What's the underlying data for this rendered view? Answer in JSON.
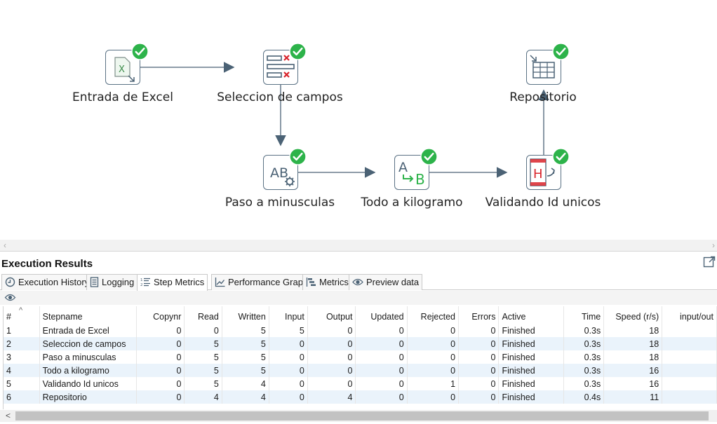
{
  "steps": [
    {
      "id": "excel",
      "label": "Entrada de Excel"
    },
    {
      "id": "select",
      "label": "Seleccion de campos"
    },
    {
      "id": "lower",
      "label": "Paso a minusculas"
    },
    {
      "id": "kilo",
      "label": "Todo a kilogramo"
    },
    {
      "id": "unique",
      "label": "Validando Id unicos"
    },
    {
      "id": "repo",
      "label": "Repositorio"
    }
  ],
  "colors": {
    "hop": "#4b6275",
    "check": "#2db34a",
    "accent_red": "#d9242c"
  },
  "scroll_top": {
    "left": "‹",
    "right": "›"
  },
  "results": {
    "title": "Execution Results",
    "tabs": [
      {
        "label": "Execution History",
        "icon": "clock-icon"
      },
      {
        "label": "Logging",
        "icon": "document-icon"
      },
      {
        "label": "Step Metrics",
        "icon": "list-numbered-icon"
      },
      {
        "label": "Performance Graph",
        "icon": "line-chart-icon"
      },
      {
        "label": "Metrics",
        "icon": "gantt-icon"
      },
      {
        "label": "Preview data",
        "icon": "eye-icon"
      }
    ],
    "columns": [
      "#",
      "Stepname",
      "Copynr",
      "Read",
      "Written",
      "Input",
      "Output",
      "Updated",
      "Rejected",
      "Errors",
      "Active",
      "Time",
      "Speed (r/s)",
      "input/out"
    ],
    "sort_indicator": "^",
    "rows": [
      [
        "1",
        "Entrada de Excel",
        "0",
        "0",
        "5",
        "5",
        "0",
        "0",
        "0",
        "0",
        "Finished",
        "0.3s",
        "18",
        ""
      ],
      [
        "2",
        "Seleccion de campos",
        "0",
        "5",
        "5",
        "0",
        "0",
        "0",
        "0",
        "0",
        "Finished",
        "0.3s",
        "18",
        ""
      ],
      [
        "3",
        "Paso a minusculas",
        "0",
        "5",
        "5",
        "0",
        "0",
        "0",
        "0",
        "0",
        "Finished",
        "0.3s",
        "18",
        ""
      ],
      [
        "4",
        "Todo a kilogramo",
        "0",
        "5",
        "5",
        "0",
        "0",
        "0",
        "0",
        "0",
        "Finished",
        "0.3s",
        "16",
        ""
      ],
      [
        "5",
        "Validando Id unicos",
        "0",
        "5",
        "4",
        "0",
        "0",
        "0",
        "1",
        "0",
        "Finished",
        "0.3s",
        "16",
        ""
      ],
      [
        "6",
        "Repositorio",
        "0",
        "4",
        "4",
        "0",
        "4",
        "0",
        "0",
        "0",
        "Finished",
        "0.4s",
        "11",
        ""
      ]
    ],
    "bottom_scroll_left": "<"
  }
}
